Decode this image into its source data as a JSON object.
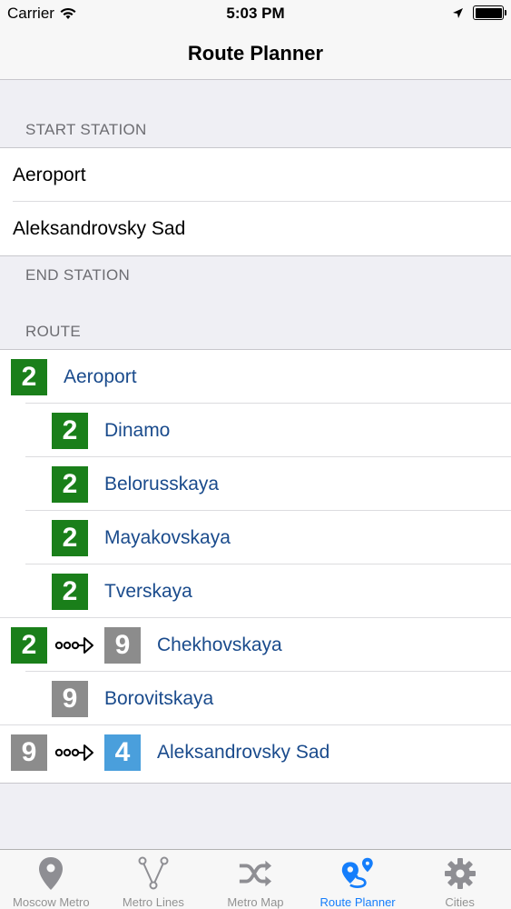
{
  "status_bar": {
    "carrier": "Carrier",
    "time": "5:03 PM"
  },
  "nav": {
    "title": "Route Planner"
  },
  "start_section": {
    "header": "START STATION",
    "rows": [
      "Aeroport",
      "Aleksandrovsky Sad"
    ]
  },
  "end_section": {
    "header": "END STATION"
  },
  "route_section": {
    "header": "ROUTE",
    "stops": [
      {
        "name": "Aeroport",
        "line": "2",
        "line_color": "#1a7f1a"
      },
      {
        "name": "Dinamo",
        "line": "2",
        "line_color": "#1a7f1a"
      },
      {
        "name": "Belorusskaya",
        "line": "2",
        "line_color": "#1a7f1a"
      },
      {
        "name": "Mayakovskaya",
        "line": "2",
        "line_color": "#1a7f1a"
      },
      {
        "name": "Tverskaya",
        "line": "2",
        "line_color": "#1a7f1a"
      },
      {
        "name": "Chekhovskaya",
        "from_line": "2",
        "from_color": "#1a7f1a",
        "line": "9",
        "line_color": "#8c8c8c"
      },
      {
        "name": "Borovitskaya",
        "line": "9",
        "line_color": "#8c8c8c"
      },
      {
        "name": "Aleksandrovsky Sad",
        "from_line": "9",
        "from_color": "#8c8c8c",
        "line": "4",
        "line_color": "#4a9fdc"
      }
    ]
  },
  "tabs": [
    {
      "label": "Moscow Metro",
      "icon": "location-pin-icon"
    },
    {
      "label": "Metro Lines",
      "icon": "metro-lines-icon"
    },
    {
      "label": "Metro Map",
      "icon": "shuffle-icon"
    },
    {
      "label": "Route Planner",
      "icon": "route-icon",
      "active": true
    },
    {
      "label": "Cities",
      "icon": "gear-icon"
    }
  ],
  "colors": {
    "accent": "#157efb",
    "station_text": "#1a4b8c",
    "line2": "#1a7f1a",
    "line9": "#8c8c8c",
    "line4": "#4a9fdc"
  }
}
